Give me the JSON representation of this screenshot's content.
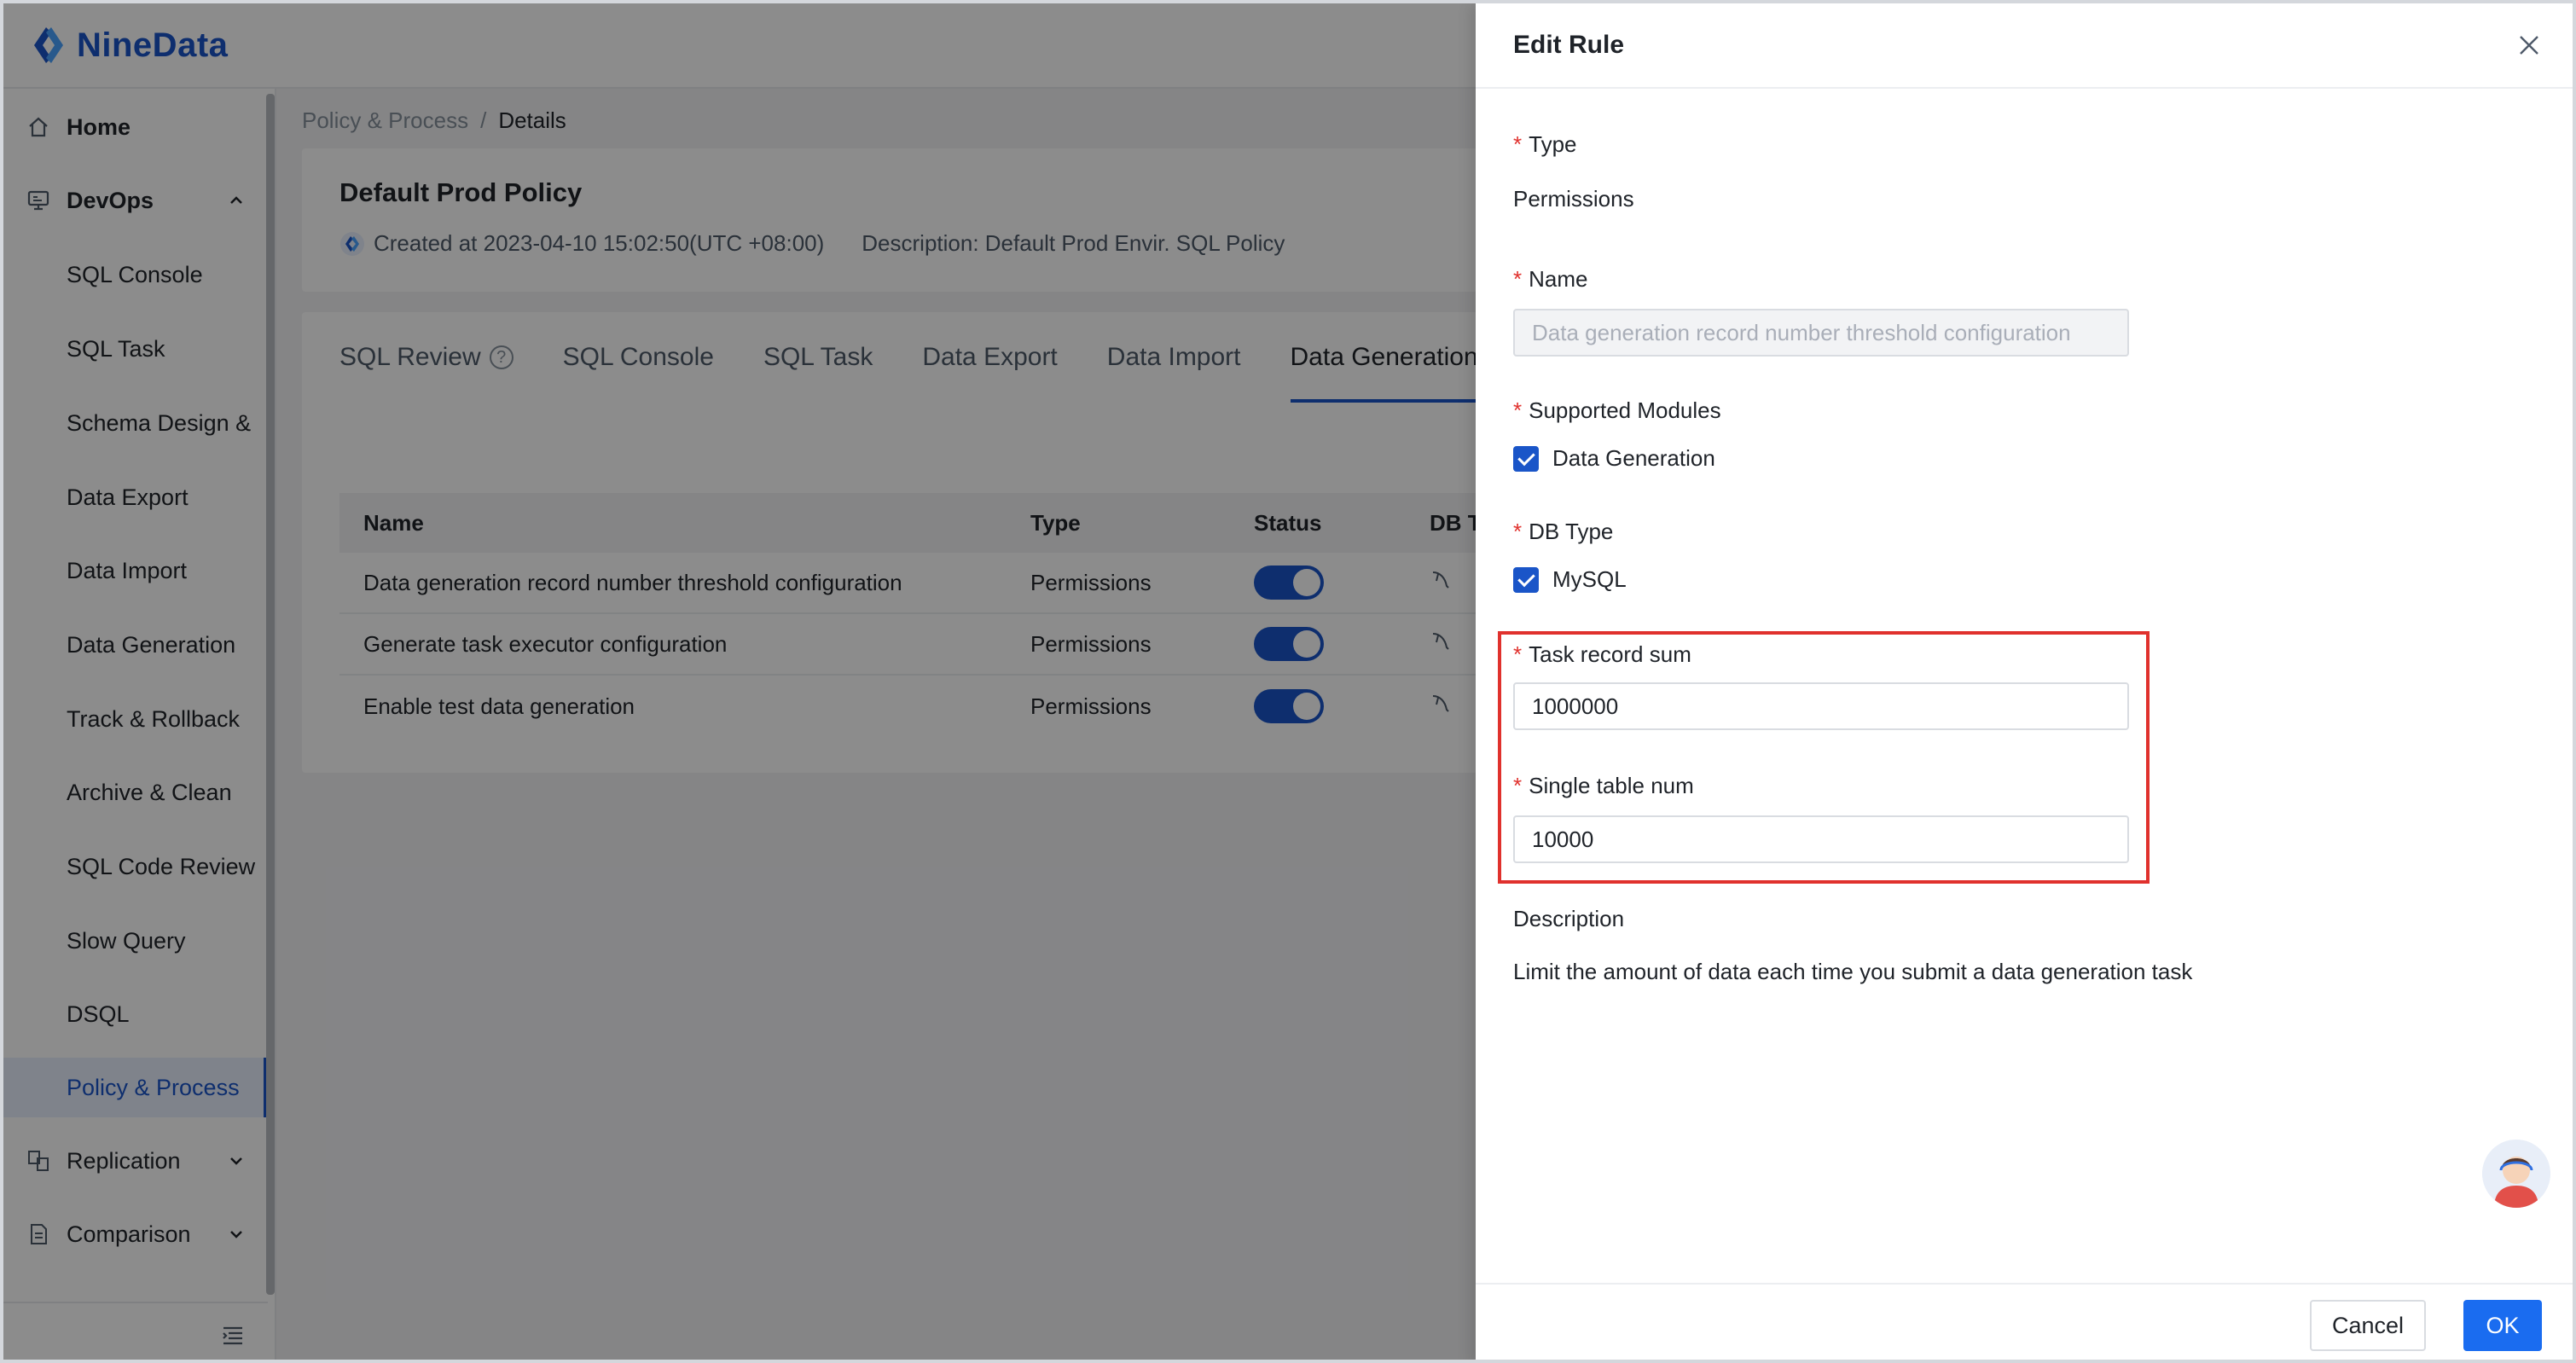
{
  "app": {
    "brand": "NineData"
  },
  "sidebar": {
    "items": [
      {
        "label": "Home",
        "icon": "home-icon"
      },
      {
        "label": "DevOps",
        "icon": "devops-icon",
        "expanded": true
      },
      {
        "label": "SQL Console"
      },
      {
        "label": "SQL Task"
      },
      {
        "label": "Schema Design &"
      },
      {
        "label": "Data Export"
      },
      {
        "label": "Data Import"
      },
      {
        "label": "Data Generation"
      },
      {
        "label": "Track & Rollback"
      },
      {
        "label": "Archive & Clean"
      },
      {
        "label": "SQL Code Review"
      },
      {
        "label": "Slow Query"
      },
      {
        "label": "DSQL"
      },
      {
        "label": "Policy & Process",
        "active": true
      },
      {
        "label": "Replication",
        "icon": "replication-icon"
      },
      {
        "label": "Comparison",
        "icon": "comparison-icon"
      }
    ]
  },
  "breadcrumb": {
    "parent": "Policy & Process",
    "separator": "/",
    "current": "Details"
  },
  "policy": {
    "title": "Default Prod Policy",
    "created": "Created at 2023-04-10 15:02:50(UTC +08:00)",
    "description": "Description:  Default Prod Envir. SQL Policy"
  },
  "tabs": [
    {
      "label": "SQL Review"
    },
    {
      "label": "SQL Console"
    },
    {
      "label": "SQL Task"
    },
    {
      "label": "Data Export"
    },
    {
      "label": "Data Import"
    },
    {
      "label": "Data Generation",
      "active": true
    }
  ],
  "table": {
    "headers": [
      "Name",
      "Type",
      "Status",
      "DB T"
    ],
    "rows": [
      {
        "name": "Data generation record number threshold configuration",
        "type": "Permissions",
        "enabled": true
      },
      {
        "name": "Generate task executor configuration",
        "type": "Permissions",
        "enabled": true
      },
      {
        "name": "Enable test data generation",
        "type": "Permissions",
        "enabled": true
      }
    ]
  },
  "drawer": {
    "title": "Edit Rule",
    "type_label": "Type",
    "type_value": "Permissions",
    "name_label": "Name",
    "name_value": "Data generation record number threshold configuration",
    "modules_label": "Supported Modules",
    "modules_value": "Data Generation",
    "dbtype_label": "DB Type",
    "dbtype_value": "MySQL",
    "task_record_label": "Task record sum",
    "task_record_value": "1000000",
    "single_table_label": "Single table num",
    "single_table_value": "10000",
    "description_label": "Description",
    "description_value": "Limit the amount of data each time you submit a data generation task",
    "cancel_label": "Cancel",
    "ok_label": "OK",
    "required_mark": "*"
  },
  "colors": {
    "accent": "#1a55c8",
    "ok_button": "#1a6cf0",
    "highlight": "#e0312d",
    "required": "#e0312d"
  }
}
